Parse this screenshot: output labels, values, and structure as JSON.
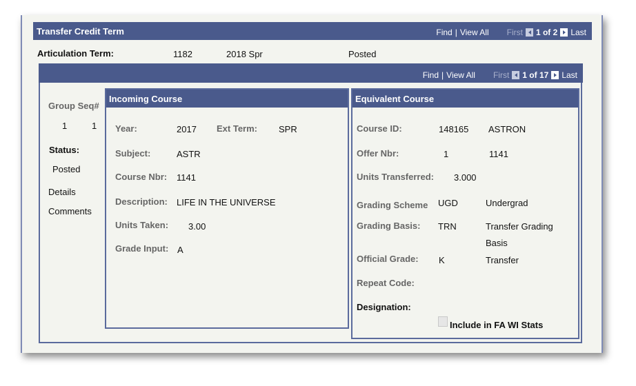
{
  "section": {
    "title": "Transfer Credit Term",
    "find": "Find",
    "view_all": "View All",
    "first": "First",
    "count": "1 of 2",
    "last": "Last"
  },
  "articulation": {
    "label": "Articulation Term:",
    "term": "1182",
    "term_desc": "2018 Spr",
    "status": "Posted"
  },
  "inner_nav": {
    "find": "Find",
    "view_all": "View All",
    "first": "First",
    "count": "1 of 17",
    "last": "Last"
  },
  "left": {
    "group_seq_label": "Group Seq#",
    "seq1": "1",
    "seq2": "1",
    "status_label": "Status:",
    "status": "Posted",
    "details": "Details",
    "comments": "Comments"
  },
  "incoming": {
    "title": "Incoming Course",
    "year_label": "Year:",
    "year": "2017",
    "ext_term_label": "Ext Term:",
    "ext_term": "SPR",
    "subject_label": "Subject:",
    "subject": "ASTR",
    "course_nbr_label": "Course Nbr:",
    "course_nbr": "1141",
    "description_label": "Description:",
    "description": "LIFE IN THE UNIVERSE",
    "units_label": "Units Taken:",
    "units": "3.00",
    "grade_label": "Grade Input:",
    "grade": "A"
  },
  "equivalent": {
    "title": "Equivalent Course",
    "course_id_label": "Course ID:",
    "course_id": "148165",
    "course_name": "ASTRON",
    "offer_label": "Offer Nbr:",
    "offer": "1",
    "offer_course": "1141",
    "units_label": "Units Transferred:",
    "units": "3.000",
    "scheme_label": "Grading Scheme",
    "scheme": "UGD",
    "scheme_desc": "Undergrad",
    "basis_label": "Grading Basis:",
    "basis": "TRN",
    "basis_desc": "Transfer Grading Basis",
    "official_label": "Official Grade:",
    "official": "K",
    "official_desc": "Transfer",
    "repeat_label": "Repeat Code:",
    "designation_label": "Designation:",
    "fa_stats_label": "Include in FA WI Stats"
  }
}
